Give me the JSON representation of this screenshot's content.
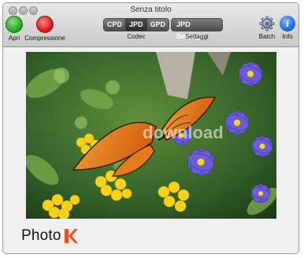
{
  "window": {
    "title": "Senza titolo"
  },
  "toolbar": {
    "apri": {
      "label": "Apri",
      "icon": "green-circle-icon"
    },
    "compressione": {
      "label": "Compressione",
      "icon": "red-circle-icon"
    },
    "codec": {
      "label": "Codec",
      "options": [
        "CPD",
        "JPD",
        "GPD"
      ],
      "selected": "JPD"
    },
    "settaggi": {
      "label": "Settaggi",
      "button_label": "JPD Settings"
    },
    "batch": {
      "label": "Batch",
      "icon": "gear-icon"
    },
    "info": {
      "label": "Info",
      "icon": "info-icon"
    }
  },
  "preview": {
    "watermark": "download"
  },
  "logo": {
    "text": "Photo",
    "mark": "K",
    "mark_color": "#e8501f"
  }
}
